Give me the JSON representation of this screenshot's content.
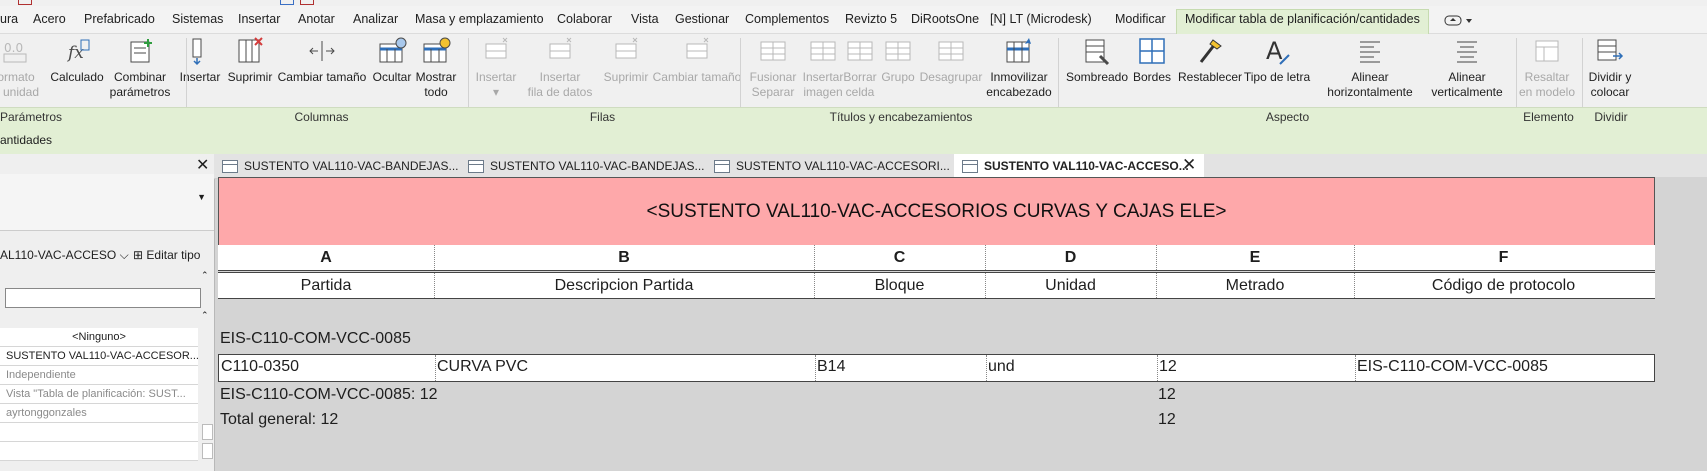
{
  "menu": {
    "items": [
      "ura",
      "Acero",
      "Prefabricado",
      "Sistemas",
      "Insertar",
      "Anotar",
      "Analizar",
      "Masa y emplazamiento",
      "Colaborar",
      "Vista",
      "Gestionar",
      "Complementos",
      "Revizto 5",
      "DiRootsOne",
      "[N] LT (Microdesk)",
      "Modificar"
    ],
    "active": "Modificar tabla de planificación/cantidades"
  },
  "ribbon": {
    "buttons": [
      {
        "l1": "ormato",
        "l2": "e unidad",
        "icon": "format-unit-icon",
        "disabled": true
      },
      {
        "l1": "Calculado",
        "l2": "",
        "icon": "calculated-icon",
        "disabled": false
      },
      {
        "l1": "Combinar",
        "l2": "parámetros",
        "icon": "combine-parameters-icon",
        "disabled": false
      },
      {
        "l1": "Insertar",
        "l2": "",
        "icon": "insert-column-icon",
        "disabled": false
      },
      {
        "l1": "Suprimir",
        "l2": "",
        "icon": "delete-column-icon",
        "disabled": false
      },
      {
        "l1": "Cambiar tamaño",
        "l2": "",
        "icon": "resize-column-icon",
        "disabled": false
      },
      {
        "l1": "Ocultar",
        "l2": "",
        "icon": "hide-column-icon",
        "disabled": false
      },
      {
        "l1": "Mostrar",
        "l2": "todo",
        "icon": "show-all-icon",
        "disabled": false
      },
      {
        "l1": "Insertar",
        "l2": "▾",
        "icon": "insert-row-icon",
        "disabled": true
      },
      {
        "l1": "Insertar",
        "l2": "fila de datos",
        "icon": "insert-data-row-icon",
        "disabled": true
      },
      {
        "l1": "Suprimir",
        "l2": "",
        "icon": "delete-row-icon",
        "disabled": true
      },
      {
        "l1": "Cambiar tamaño",
        "l2": "",
        "icon": "resize-row-icon",
        "disabled": true
      },
      {
        "l1": "Fusionar",
        "l2": "Separar",
        "icon": "merge-icon",
        "disabled": true
      },
      {
        "l1": "Insertar",
        "l2": "imagen",
        "icon": "insert-image-icon",
        "disabled": true
      },
      {
        "l1": "Borrar",
        "l2": "celda",
        "icon": "clear-cell-icon",
        "disabled": true
      },
      {
        "l1": "Grupo",
        "l2": "",
        "icon": "group-icon",
        "disabled": true
      },
      {
        "l1": "Desagrupar",
        "l2": "",
        "icon": "ungroup-icon",
        "disabled": true
      },
      {
        "l1": "Inmovilizar",
        "l2": "encabezado",
        "icon": "freeze-header-icon",
        "disabled": false
      },
      {
        "l1": "Sombreado",
        "l2": "",
        "icon": "shading-icon",
        "disabled": false
      },
      {
        "l1": "Bordes",
        "l2": "",
        "icon": "borders-icon",
        "disabled": false
      },
      {
        "l1": "Restablecer",
        "l2": "",
        "icon": "reset-icon",
        "disabled": false
      },
      {
        "l1": "Tipo de letra",
        "l2": "",
        "icon": "font-icon",
        "disabled": false
      },
      {
        "l1": "Alinear",
        "l2": "horizontalmente",
        "icon": "align-horizontal-icon",
        "disabled": false
      },
      {
        "l1": "Alinear",
        "l2": "verticalmente",
        "icon": "align-vertical-icon",
        "disabled": false
      },
      {
        "l1": "Resaltar",
        "l2": "en modelo",
        "icon": "highlight-in-model-icon",
        "disabled": true
      },
      {
        "l1": "Dividir y",
        "l2": "colocar",
        "icon": "split-place-icon",
        "disabled": false
      }
    ],
    "panels": [
      "Parámetros",
      "Columnas",
      "Filas",
      "Títulos y encabezamientos",
      "Aspecto",
      "Elemento",
      "Dividir"
    ]
  },
  "context_label": "antidades",
  "left_panel": {
    "type_value": "AL110-VAC-ACCESO",
    "edit_type": "Editar tipo",
    "props": [
      "<Ninguno>",
      "SUSTENTO VAL110-VAC-ACCESOR...",
      "Independiente",
      "Vista \"Tabla de planificación: SUST...",
      "ayrtonggonzales"
    ]
  },
  "tabs": [
    {
      "label": "SUSTENTO VAL110-VAC-BANDEJAS...",
      "active": false
    },
    {
      "label": "SUSTENTO VAL110-VAC-BANDEJAS...",
      "active": false
    },
    {
      "label": "SUSTENTO VAL110-VAC-ACCESORI...",
      "active": false
    },
    {
      "label": "SUSTENTO VAL110-VAC-ACCESO...",
      "active": true
    }
  ],
  "schedule": {
    "title": "<SUSTENTO VAL110-VAC-ACCESORIOS CURVAS Y CAJAS ELE>",
    "letters": [
      "A",
      "B",
      "C",
      "D",
      "E",
      "F"
    ],
    "headers": [
      "Partida",
      "Descripcion Partida",
      "Bloque",
      "Unidad",
      "Metrado",
      "Código de protocolo"
    ],
    "group_header": "EIS-C110-COM-VCC-0085",
    "row": [
      "C110-0350",
      "CURVA PVC",
      "B14",
      "und",
      "12",
      "EIS-C110-COM-VCC-0085"
    ],
    "group_footer_label": "EIS-C110-COM-VCC-0085: 12",
    "group_footer_value": "12",
    "total_label": "Total general: 12",
    "total_value": "12"
  },
  "colors": {
    "title_bg": "#fea8aa",
    "ribbon_context": "#e2efd4"
  }
}
